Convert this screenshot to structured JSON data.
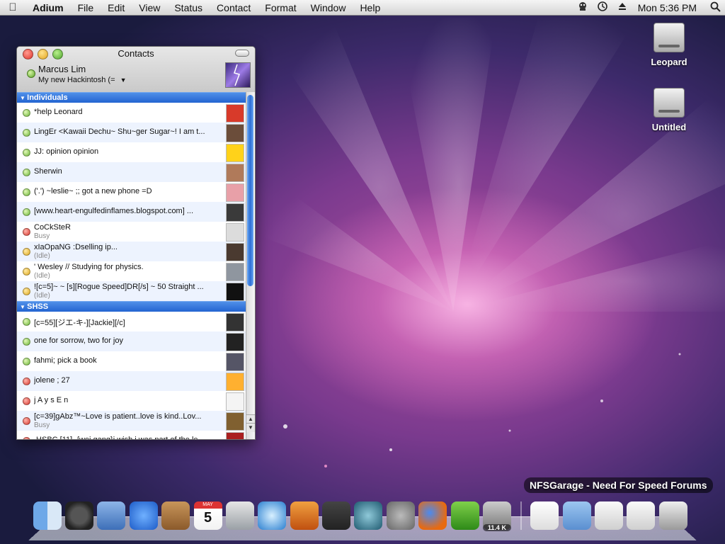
{
  "menubar": {
    "app": "Adium",
    "items": [
      "File",
      "Edit",
      "View",
      "Status",
      "Contact",
      "Format",
      "Window",
      "Help"
    ],
    "clock": "Mon 5:36 PM"
  },
  "desktop": {
    "icons": [
      "Leopard",
      "Untitled"
    ]
  },
  "window": {
    "title": "Contacts",
    "me": {
      "name": "Marcus Lim",
      "status": "My new Hackintosh (="
    }
  },
  "groups": [
    {
      "name": "Individuals",
      "contacts": [
        {
          "name": "*help Leonard",
          "status": "online"
        },
        {
          "name": "LingEr <Kawaii Dechu~ Shu~ger Sugar~! I am t...",
          "status": "online"
        },
        {
          "name": "JJ: opinion opinion",
          "status": "online"
        },
        {
          "name": "Sherwin",
          "status": "online"
        },
        {
          "name": "('.') ~leslie~          ;; got a new phone =D",
          "status": "online"
        },
        {
          "name": "[www.heart-engulfedinflames.blogspot.com]    ...",
          "status": "online"
        },
        {
          "name": "CoCkSteR",
          "sub": "Busy",
          "status": "busy"
        },
        {
          "name": "xIaOpaNG                                         :Dselling ip...",
          "sub": "(Idle)",
          "status": "idle"
        },
        {
          "name": "'      Wesley // Studying for physics.",
          "sub": "(Idle)",
          "status": "idle"
        },
        {
          "name": "![c=5]~ ~ [s][Rogue Speed]DR[/s] ~ 50 Straight ...",
          "sub": "(Idle)",
          "status": "idle"
        }
      ]
    },
    {
      "name": "SHSS",
      "contacts": [
        {
          "name": "[c=55][ジエ-キ-][Jackie][/c]",
          "status": "online"
        },
        {
          "name": "one for sorrow, two for joy",
          "status": "online"
        },
        {
          "name": "fahmi; pick a book",
          "status": "online"
        },
        {
          "name": "jolene   ;          27",
          "status": "busy"
        },
        {
          "name": "j A y s E n",
          "status": "busy"
        },
        {
          "name": "[c=39]gAbz™~Love is patient..love is kind..Lov...",
          "sub": "Busy",
          "status": "busy"
        },
        {
          "name": ".HSBC [11]. {wei gang}i wish i was part of the le...",
          "status": "busy"
        }
      ]
    }
  ],
  "dock": {
    "tooltip": "NFSGarage - Need For Speed Forums",
    "badge": "11.4 K",
    "items": [
      "Finder",
      "Dashboard",
      "Mail",
      "iChat",
      "Address Book",
      "iCal",
      "Preview",
      "iTunes",
      "iPhoto",
      "Spaces",
      "Time Machine",
      "System Preferences",
      "Firefox",
      "Adium",
      "Transmission",
      "PDF",
      "Documents",
      "Window 1",
      "Window 2",
      "Trash"
    ],
    "calendar": {
      "month": "MAY",
      "day": "5"
    }
  },
  "colors": {
    "group_header": "#2364d1",
    "online": "#6cb536",
    "busy": "#d8382e",
    "idle": "#e0a91f"
  }
}
